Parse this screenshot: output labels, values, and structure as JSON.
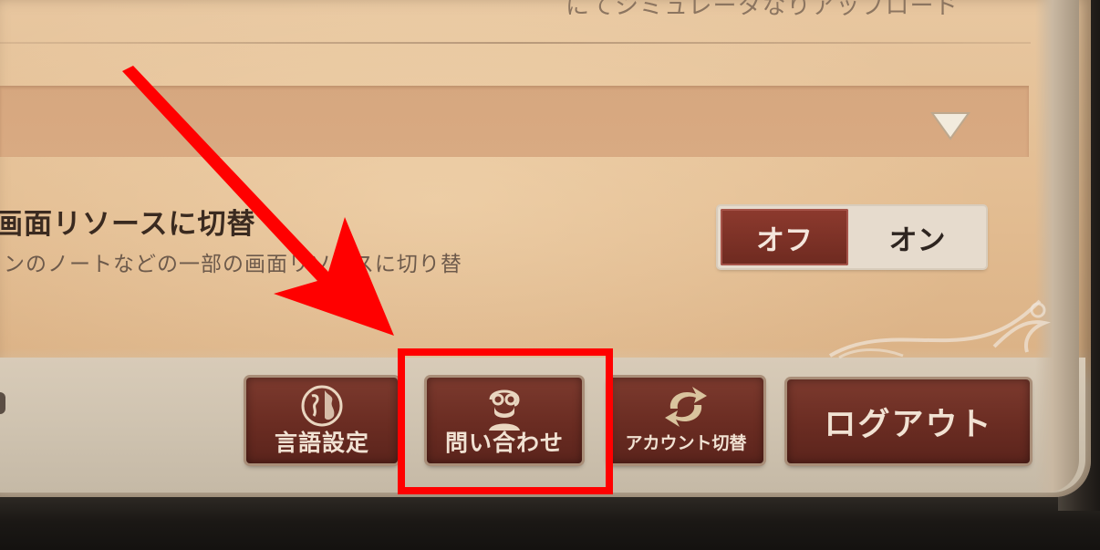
{
  "top_partial_text": "にてシミュレータなりアップロード",
  "setting": {
    "title": "画面リソースに切替",
    "description": "ンのノートなどの一部の画面リソースに切り替"
  },
  "toggle": {
    "off_label": "オフ",
    "on_label": "オン",
    "selected": "オフ"
  },
  "buttons": {
    "language": "言語設定",
    "contact": "問い合わせ",
    "account_switch": "アカウント切替",
    "logout": "ログアウト"
  },
  "icons": {
    "dropdown": "triangle-down-icon",
    "language": "globe-icon",
    "contact": "support-person-icon",
    "account_switch": "refresh-arrows-icon"
  },
  "colors": {
    "button_red": "#6a2c22",
    "button_text": "#f1e2d3",
    "highlight_red": "#ff0000",
    "paper": "#e3bd92"
  }
}
